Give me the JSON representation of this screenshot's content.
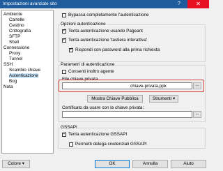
{
  "window": {
    "title": "Impostazioni avanzate sito",
    "help_label": "?",
    "close_label": "✕"
  },
  "tree": [
    {
      "label": "Ambiente",
      "depth": 0
    },
    {
      "label": "Cartelle",
      "depth": 1
    },
    {
      "label": "Cestino",
      "depth": 1
    },
    {
      "label": "Crittografia",
      "depth": 1
    },
    {
      "label": "SFTP",
      "depth": 1
    },
    {
      "label": "Shell",
      "depth": 1
    },
    {
      "label": "Connessione",
      "depth": 0
    },
    {
      "label": "Proxy",
      "depth": 1
    },
    {
      "label": "Tunnel",
      "depth": 1
    },
    {
      "label": "SSH",
      "depth": 0
    },
    {
      "label": "Scambio chiave",
      "depth": 1
    },
    {
      "label": "Autenticazione",
      "depth": 1,
      "selected": true
    },
    {
      "label": "Bug",
      "depth": 1
    },
    {
      "label": "Nota",
      "depth": 0
    }
  ],
  "bypass": {
    "label": "Bypassa completamente l'autenticazione",
    "checked": false
  },
  "auth_options": {
    "title": "Opzioni autenticazione",
    "pageant": {
      "label": "Tenta autenticazione usando Pageant",
      "checked": true
    },
    "keyboard": {
      "label": "Tenta autenticazione 'tastiera interattiva'",
      "checked": true
    },
    "respond_pwd": {
      "label": "Rispondi con password alla prima richiesta",
      "checked": true
    }
  },
  "auth_params": {
    "title": "Parametri di autenticazione",
    "agent_forward": {
      "label": "Consenti inoltro agente",
      "checked": false
    },
    "private_key_label": "File chiave privata",
    "private_key_value": "chiave-privata.ppk",
    "browse_label": "...",
    "show_public_key_label": "Mostra Chiave Pubblica",
    "tools_label": "Strumenti",
    "cert_label": "Certificato da usare con la chiave privata:",
    "cert_value": ""
  },
  "gssapi": {
    "title": "GSSAPI",
    "try_gssapi": {
      "label": "Tenta autenticazione GSSAPI",
      "checked": true
    },
    "delegation": {
      "label": "Permetti delega credenziali GSSAPI",
      "checked": false
    }
  },
  "footer": {
    "color_label": "Colore",
    "ok_label": "OK",
    "cancel_label": "Annulla",
    "help_label": "Aiuto"
  },
  "colors": {
    "titlebar": "#1f5c9c",
    "close": "#e81123",
    "highlight": "#d63c3c",
    "selection": "#cce8ff"
  }
}
